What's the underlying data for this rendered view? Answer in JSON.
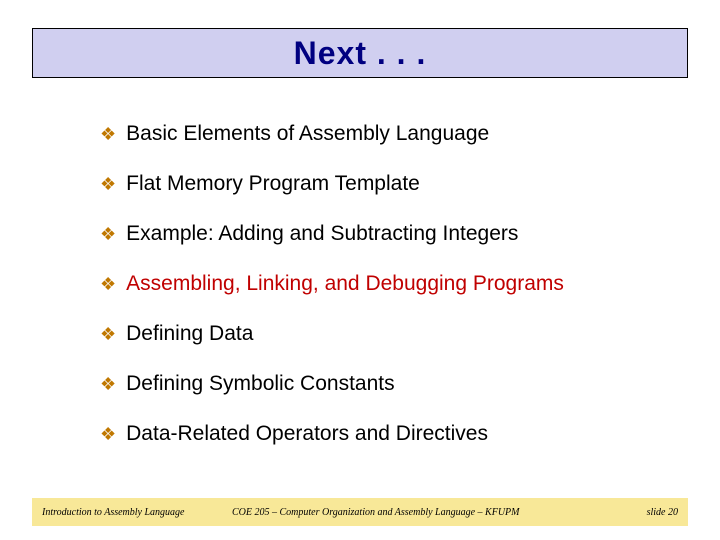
{
  "header": {
    "title": "Next . . ."
  },
  "topics": [
    {
      "text": "Basic Elements of Assembly Language",
      "highlight": false
    },
    {
      "text": "Flat Memory Program Template",
      "highlight": false
    },
    {
      "text": "Example: Adding and Subtracting Integers",
      "highlight": false
    },
    {
      "text": "Assembling, Linking, and Debugging Programs",
      "highlight": true
    },
    {
      "text": "Defining Data",
      "highlight": false
    },
    {
      "text": "Defining Symbolic Constants",
      "highlight": false
    },
    {
      "text": "Data-Related Operators and Directives",
      "highlight": false
    }
  ],
  "footer": {
    "left": "Introduction to Assembly Language",
    "center": "COE 205 – Computer Organization and Assembly Language – KFUPM",
    "right": "slide 20"
  }
}
